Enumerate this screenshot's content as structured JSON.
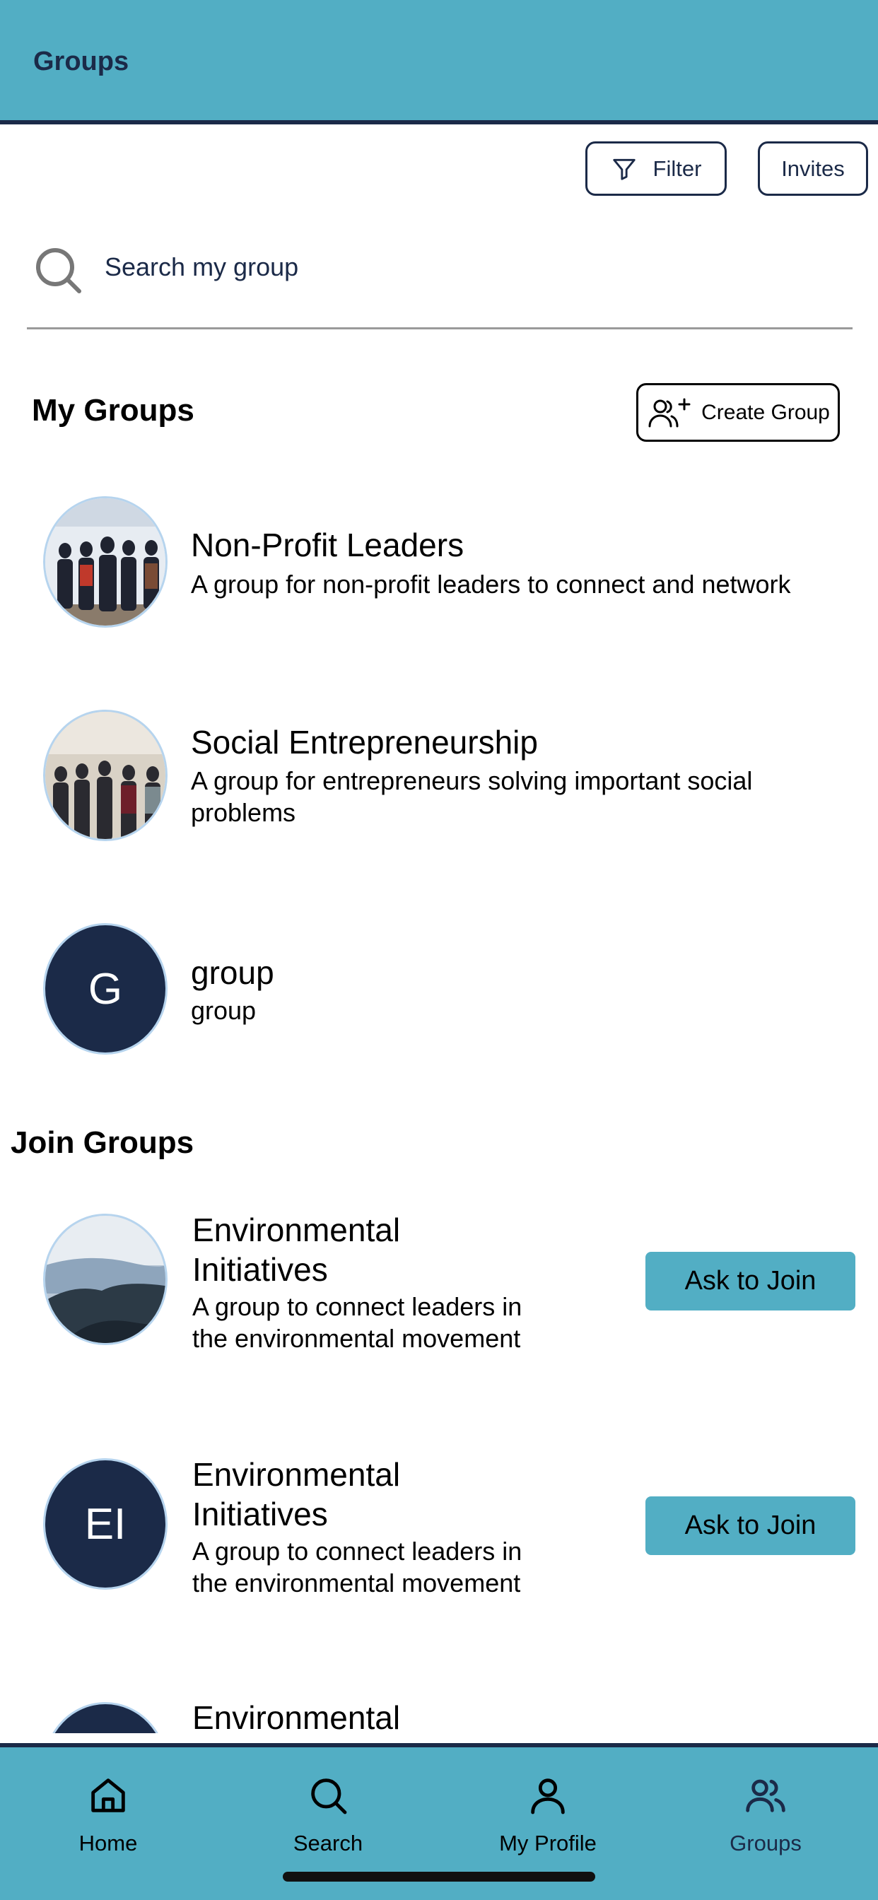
{
  "header": {
    "title": "Groups"
  },
  "actions": {
    "filter_label": "Filter",
    "invites_label": "Invites"
  },
  "search": {
    "placeholder": "Search my group"
  },
  "my_groups": {
    "title": "My Groups",
    "create_label": "Create Group",
    "items": [
      {
        "name": "Non-Profit Leaders",
        "description": "A group for non-profit leaders to connect and network",
        "avatar": "photo"
      },
      {
        "name": "Social Entrepreneurship",
        "description": "A group for entrepreneurs solving important social problems",
        "avatar": "photo"
      },
      {
        "name": "group",
        "description": "group",
        "avatar_letters": "G"
      }
    ]
  },
  "join_groups": {
    "title": "Join Groups",
    "items": [
      {
        "name": "Environmental Initiatives",
        "description": "A group to connect leaders in the environmental movement",
        "action_label": "Ask to Join",
        "avatar": "photo"
      },
      {
        "name": "Environmental Initiatives",
        "description": "A group to connect leaders in the environmental movement",
        "action_label": "Ask to Join",
        "avatar_letters": "EI"
      },
      {
        "name": "Environmental",
        "avatar": "letter-partial"
      }
    ]
  },
  "tabs": [
    {
      "label": "Home",
      "icon": "home-icon"
    },
    {
      "label": "Search",
      "icon": "search-icon"
    },
    {
      "label": "My Profile",
      "icon": "profile-icon"
    },
    {
      "label": "Groups",
      "icon": "groups-icon",
      "active": true
    }
  ],
  "colors": {
    "primary": "#52aec4",
    "navy": "#1b2a48",
    "white": "#ffffff"
  }
}
